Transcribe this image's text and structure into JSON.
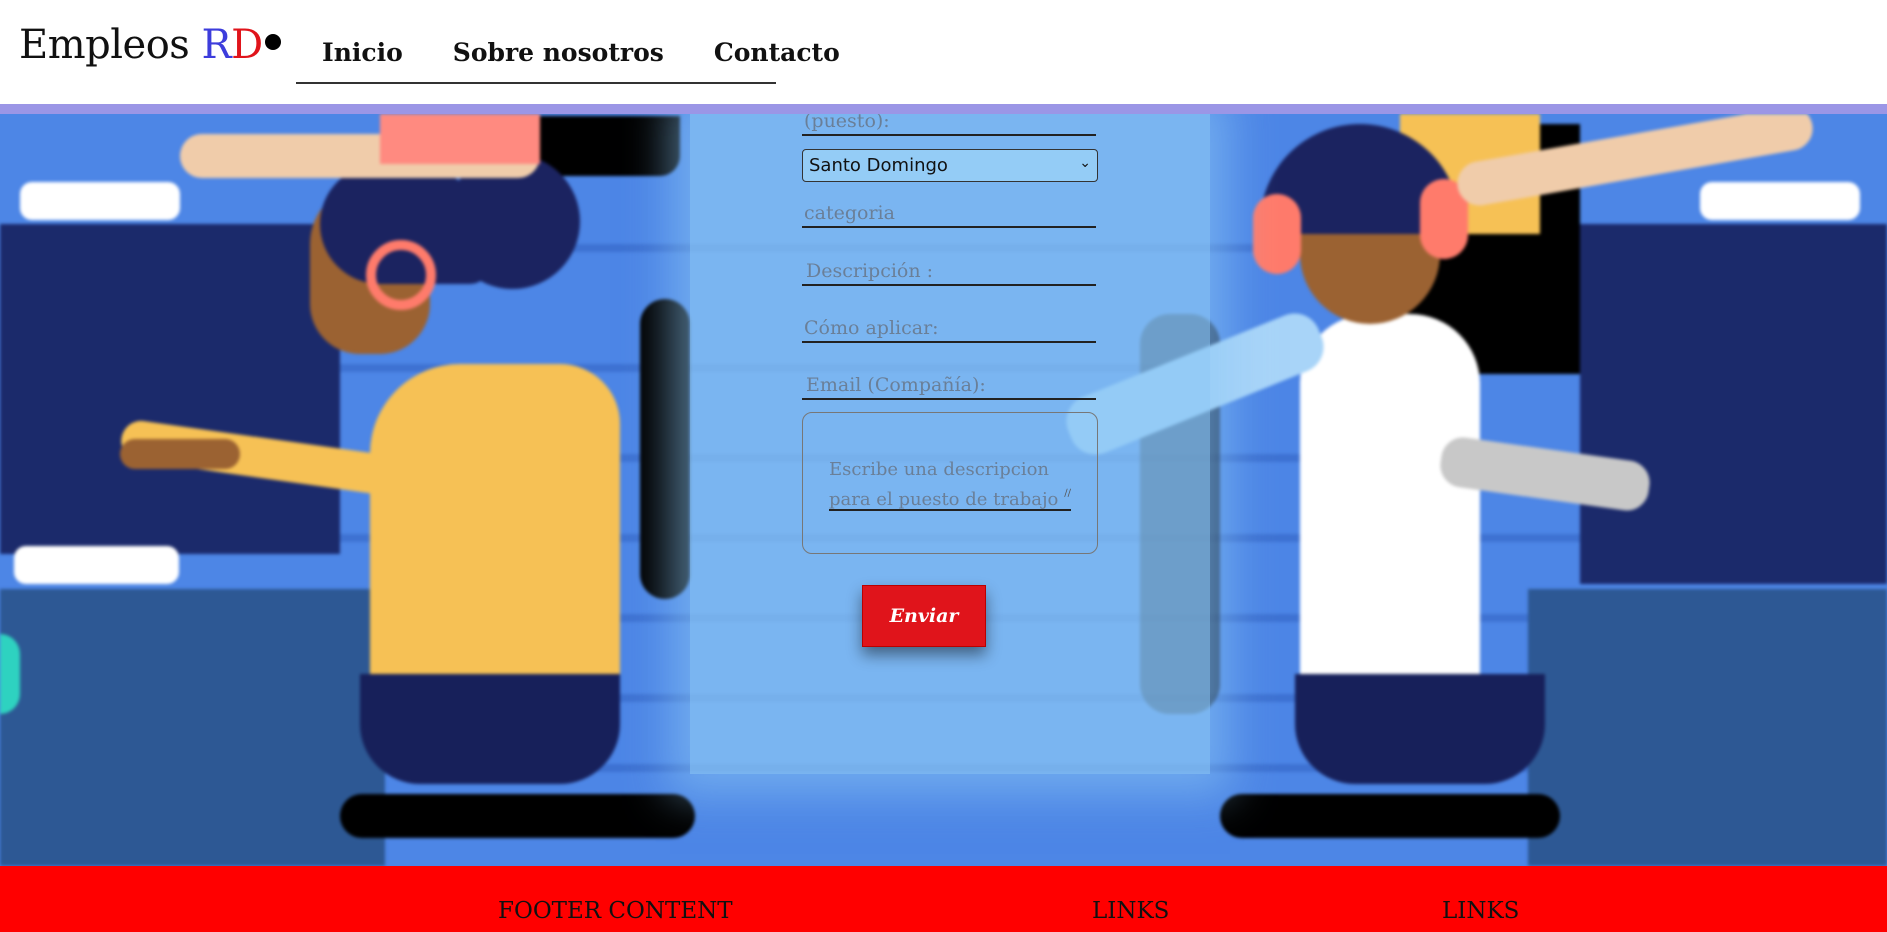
{
  "header": {
    "brand_text": "Empleos ",
    "brand_r": "R",
    "brand_d": "D",
    "nav": [
      {
        "label": "Inicio"
      },
      {
        "label": "Sobre nosotros"
      },
      {
        "label": "Contacto"
      }
    ]
  },
  "form": {
    "puesto_placeholder": "(puesto):",
    "location_select": {
      "selected": "Santo Domingo"
    },
    "categoria_placeholder": "categoria",
    "descripcion_placeholder": "Descripción :",
    "como_aplicar_placeholder": "Cómo aplicar:",
    "email_placeholder": "Email (Compañía):",
    "textarea_placeholder_line1": "Escribe una descripcion",
    "textarea_placeholder_line2": "para el puesto de trabajo",
    "submit_label": "Enviar"
  },
  "footer": {
    "col1_title": "FOOTER CONTENT",
    "col2_title": "LINKS",
    "col3_title": "LINKS"
  },
  "colors": {
    "brand_r": "#3d3ddc",
    "brand_d": "#e0141b",
    "footer_bg": "#ff0000",
    "button_bg": "#e0141b",
    "header_strip": "#9b96e6",
    "background_scene": "#4d86e6"
  }
}
